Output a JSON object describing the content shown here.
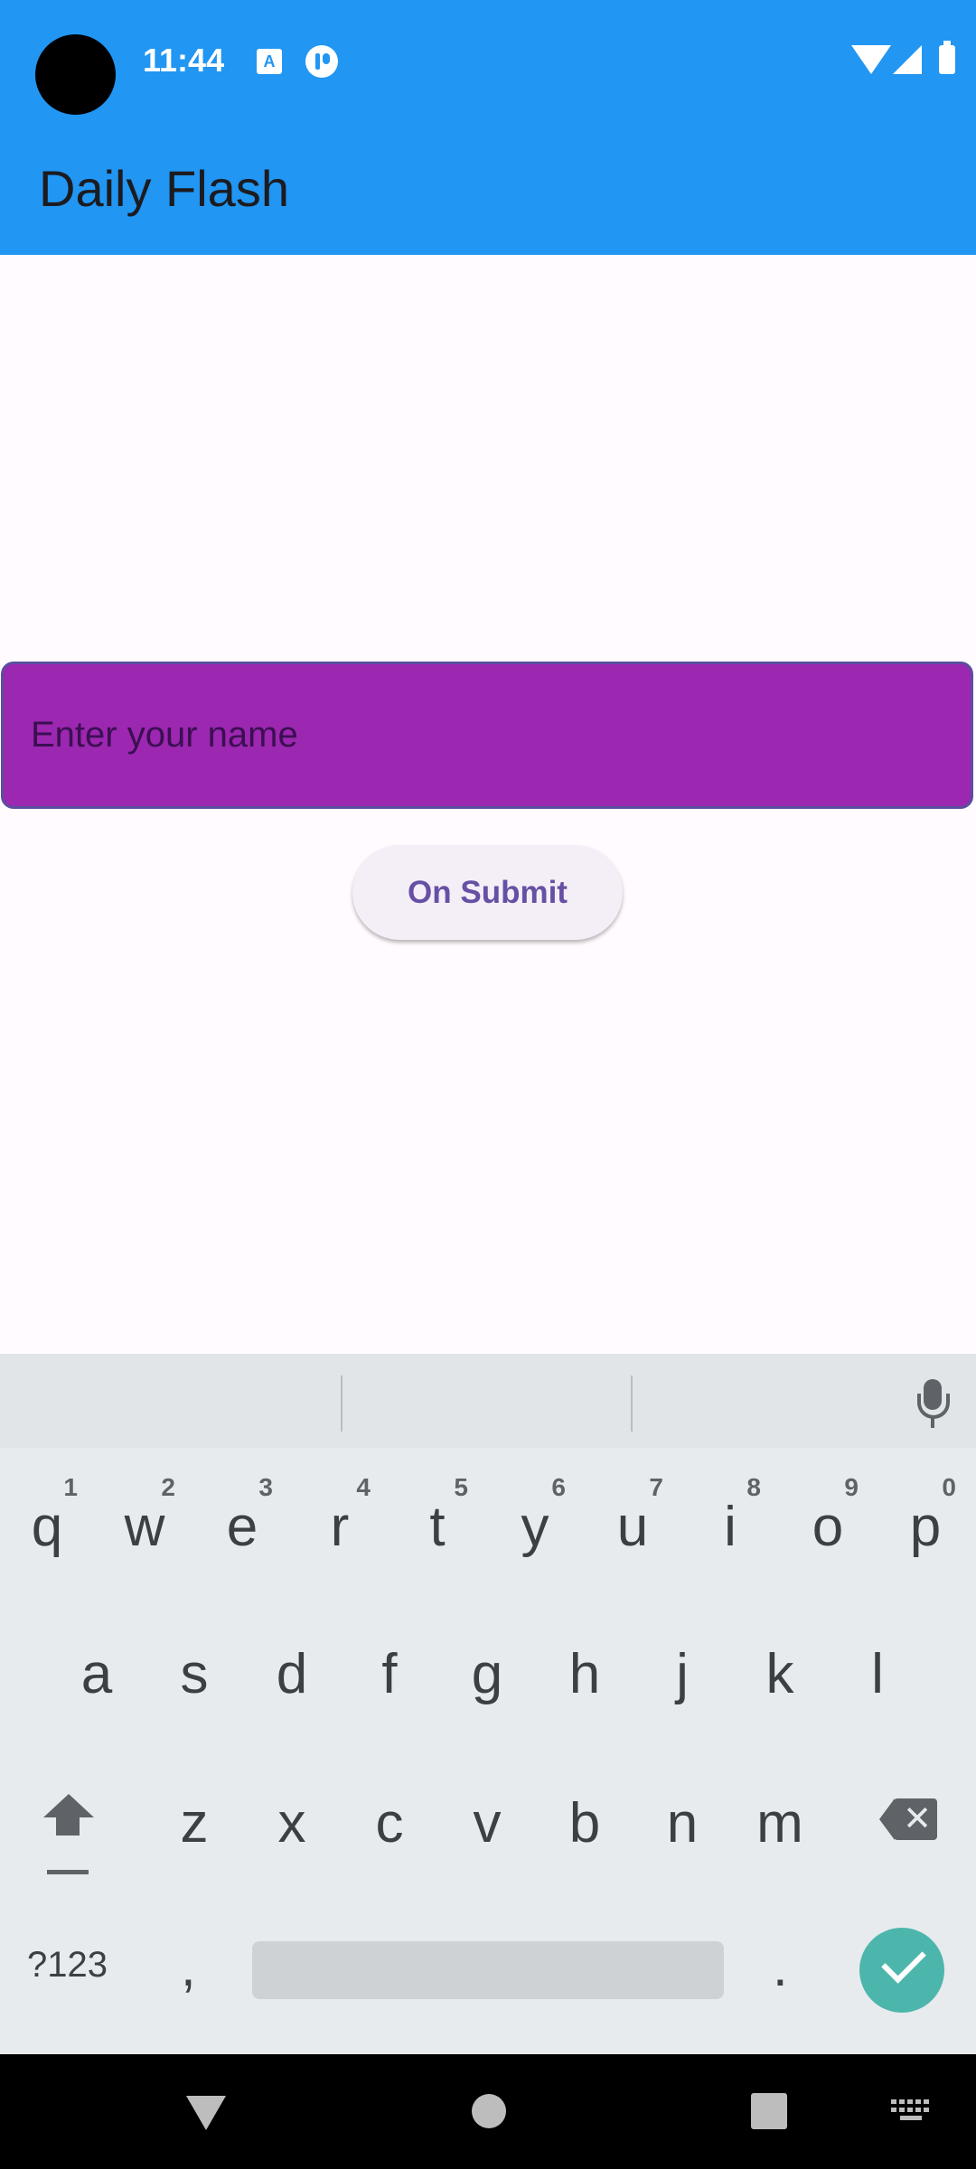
{
  "status_bar": {
    "time": "11:44"
  },
  "app_bar": {
    "title": "Daily Flash"
  },
  "form": {
    "name_placeholder": "Enter your name",
    "submit_label": "On Submit"
  },
  "keyboard": {
    "row1": [
      {
        "key": "q",
        "hint": "1"
      },
      {
        "key": "w",
        "hint": "2"
      },
      {
        "key": "e",
        "hint": "3"
      },
      {
        "key": "r",
        "hint": "4"
      },
      {
        "key": "t",
        "hint": "5"
      },
      {
        "key": "y",
        "hint": "6"
      },
      {
        "key": "u",
        "hint": "7"
      },
      {
        "key": "i",
        "hint": "8"
      },
      {
        "key": "o",
        "hint": "9"
      },
      {
        "key": "p",
        "hint": "0"
      }
    ],
    "row2": [
      "a",
      "s",
      "d",
      "f",
      "g",
      "h",
      "j",
      "k",
      "l"
    ],
    "row3": [
      "z",
      "x",
      "c",
      "v",
      "b",
      "n",
      "m"
    ],
    "symbols_label": "?123",
    "comma_label": ",",
    "period_label": "."
  },
  "colors": {
    "app_bar": "#2196f3",
    "name_field": "#9c27b0",
    "submit_text": "#6750a4",
    "enter_key": "#4db6ac"
  },
  "icons": [
    "mic-icon",
    "shift-icon",
    "backspace-icon",
    "check-icon",
    "nav-back-icon",
    "nav-home-icon",
    "nav-recents-icon",
    "keyboard-switch-icon"
  ]
}
